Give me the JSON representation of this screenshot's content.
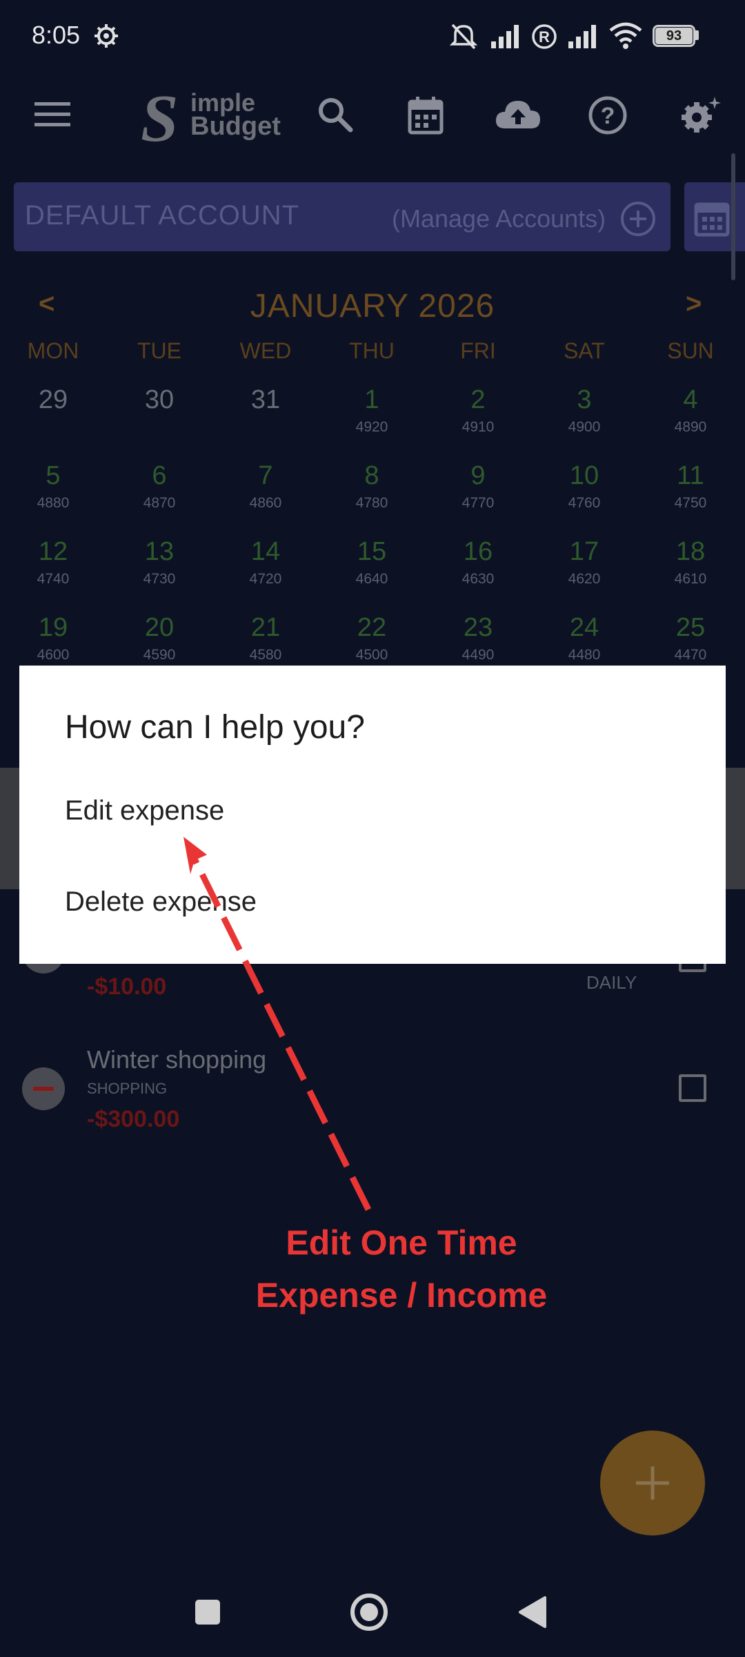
{
  "status_bar": {
    "time": "8:05",
    "battery": "93",
    "icons": [
      "settings-gear-icon",
      "mute-icon",
      "signal-icon",
      "roaming-icon",
      "signal-icon",
      "wifi-icon",
      "battery-icon"
    ]
  },
  "toolbar": {
    "icons": [
      "menu-icon",
      "search-icon",
      "calendar-icon",
      "cloud-upload-icon",
      "help-icon",
      "settings-icon"
    ],
    "logo_line1": "imple",
    "logo_line2": "Budget",
    "logo_letter": "S"
  },
  "account": {
    "name": "DEFAULT ACCOUNT",
    "manage_label": "(Manage Accounts)"
  },
  "calendar": {
    "month_title": "JANUARY 2026",
    "prev_label": "<",
    "next_label": ">",
    "weekdays": [
      "MON",
      "TUE",
      "WED",
      "THU",
      "FRI",
      "SAT",
      "SUN"
    ],
    "weeks": [
      [
        {
          "day": "29",
          "balance": "",
          "prev": true
        },
        {
          "day": "30",
          "balance": "",
          "prev": true
        },
        {
          "day": "31",
          "balance": "",
          "prev": true
        },
        {
          "day": "1",
          "balance": "4920"
        },
        {
          "day": "2",
          "balance": "4910"
        },
        {
          "day": "3",
          "balance": "4900"
        },
        {
          "day": "4",
          "balance": "4890"
        }
      ],
      [
        {
          "day": "5",
          "balance": "4880"
        },
        {
          "day": "6",
          "balance": "4870"
        },
        {
          "day": "7",
          "balance": "4860"
        },
        {
          "day": "8",
          "balance": "4780"
        },
        {
          "day": "9",
          "balance": "4770"
        },
        {
          "day": "10",
          "balance": "4760"
        },
        {
          "day": "11",
          "balance": "4750"
        }
      ],
      [
        {
          "day": "12",
          "balance": "4740"
        },
        {
          "day": "13",
          "balance": "4730"
        },
        {
          "day": "14",
          "balance": "4720"
        },
        {
          "day": "15",
          "balance": "4640"
        },
        {
          "day": "16",
          "balance": "4630"
        },
        {
          "day": "17",
          "balance": "4620"
        },
        {
          "day": "18",
          "balance": "4610"
        }
      ],
      [
        {
          "day": "19",
          "balance": "4600"
        },
        {
          "day": "20",
          "balance": "4590"
        },
        {
          "day": "21",
          "balance": "4580"
        },
        {
          "day": "22",
          "balance": "4500"
        },
        {
          "day": "23",
          "balance": "4490"
        },
        {
          "day": "24",
          "balance": "4480"
        },
        {
          "day": "25",
          "balance": "4470"
        }
      ]
    ]
  },
  "list": {
    "item1": {
      "amount": "-$10.00",
      "frequency": "DAILY"
    },
    "item2": {
      "title": "Winter shopping",
      "category": "SHOPPING",
      "amount": "-$300.00"
    }
  },
  "dialog": {
    "title": "How can I help you?",
    "options": [
      "Edit expense",
      "Delete expense"
    ]
  },
  "annotation": {
    "line1": "Edit One Time",
    "line2": "Expense / Income",
    "color": "#ea3535"
  },
  "fab": {
    "label": "+"
  },
  "nav": {
    "icons": [
      "recents-icon",
      "home-icon",
      "back-icon"
    ]
  }
}
